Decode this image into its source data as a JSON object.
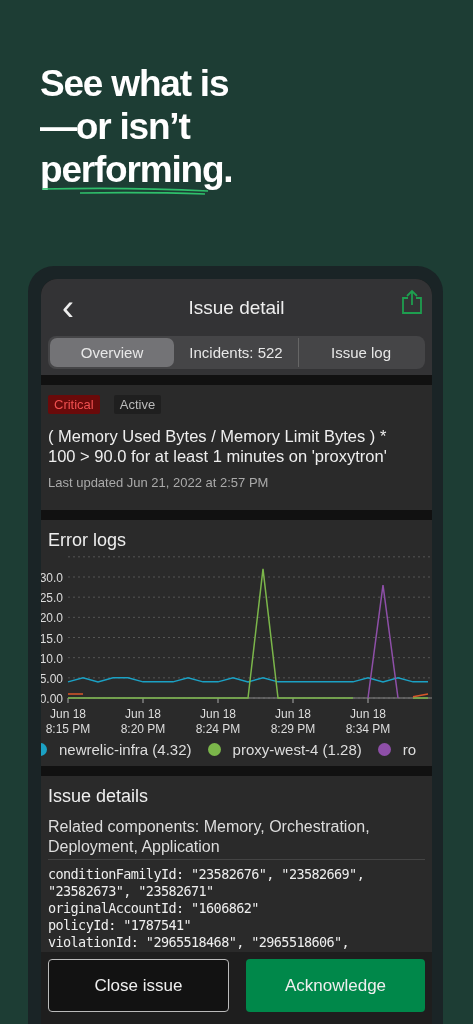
{
  "headline": {
    "lines": [
      "See what is",
      "—or isn’t",
      "performing."
    ]
  },
  "header": {
    "back_icon": "‹",
    "title": "Issue detail"
  },
  "tabs": [
    {
      "label": "Overview",
      "selected": true
    },
    {
      "label": "Incidents: 522",
      "selected": false
    },
    {
      "label": "Issue log",
      "selected": false
    }
  ],
  "issue": {
    "tags": [
      {
        "label": "Critical",
        "kind": "critical"
      },
      {
        "label": "Active",
        "kind": "status"
      }
    ],
    "condition": "( Memory Used Bytes / Memory Limit Bytes ) * 100 > 90.0 for at least 1 minutes on 'proxytron'",
    "updated": "Last updated Jun 21, 2022 at 2:57 PM"
  },
  "error_logs": {
    "title": "Error logs",
    "chart_data": {
      "type": "line",
      "categories": [
        "Jun 18 8:15 PM",
        null,
        null,
        null,
        null,
        "Jun 18 8:20 PM",
        null,
        null,
        null,
        null,
        "Jun 18 8:24 PM",
        null,
        null,
        null,
        null,
        "Jun 18 8:29 PM",
        null,
        null,
        null,
        null,
        "Jun 18 8:34 PM",
        null,
        null,
        null,
        null
      ],
      "ylim": [
        0,
        35
      ],
      "yticks": [
        {
          "value": 0,
          "label": "0.00"
        },
        {
          "value": 5,
          "label": "5.00"
        },
        {
          "value": 10,
          "label": "10.0"
        },
        {
          "value": 15,
          "label": "15.0"
        },
        {
          "value": 20,
          "label": "20.0"
        },
        {
          "value": 25,
          "label": "25.0"
        },
        {
          "value": 30,
          "label": "30.0"
        }
      ],
      "series": [
        {
          "name": "newrelic-infra (4.32)",
          "color": "#1ba1c4",
          "values": [
            4,
            5,
            4,
            5,
            5,
            4,
            4,
            4,
            5,
            4,
            4,
            5,
            4,
            5,
            4,
            4,
            4,
            4,
            4,
            4,
            5,
            4,
            5,
            4,
            4
          ]
        },
        {
          "name": "proxy-west-4 (1.28)",
          "color": "#7bb64a",
          "values": [
            0,
            0,
            0,
            0,
            0,
            0,
            0,
            0,
            0,
            0,
            0,
            0,
            0,
            32,
            0,
            0,
            0,
            0,
            0,
            0,
            null,
            null,
            null,
            0,
            0
          ]
        },
        {
          "name": "ro",
          "color": "#8e4fa8",
          "values": [
            null,
            null,
            null,
            null,
            null,
            null,
            null,
            null,
            null,
            null,
            null,
            null,
            null,
            null,
            null,
            null,
            null,
            null,
            null,
            null,
            0,
            28,
            0,
            null,
            null
          ]
        },
        {
          "color": "#d8572a",
          "values": [
            1,
            1,
            null,
            null,
            null,
            null,
            null,
            null,
            null,
            null,
            null,
            null,
            null,
            null,
            null,
            null,
            null,
            null,
            null,
            null,
            null,
            null,
            null,
            0.3,
            1
          ]
        }
      ],
      "grid": true
    }
  },
  "issue_details": {
    "title": "Issue details",
    "related": "Related components: Memory, Orchestration, Deployment, Application",
    "fields": [
      "conditionFamilyId: \"23582676\", \"23582669\", \"23582673\", \"23582671\"",
      "originalAccountId: \"1606862\"",
      "policyId: \"1787541\"",
      "violationId: \"2965518468\", \"2965518606\","
    ]
  },
  "buttons": [
    {
      "label": "Close issue",
      "kind": "secondary"
    },
    {
      "label": "Acknowledge",
      "kind": "primary"
    }
  ]
}
